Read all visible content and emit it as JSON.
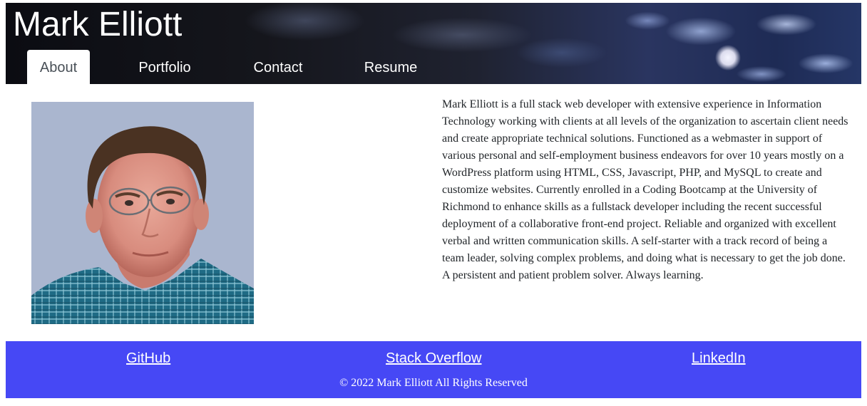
{
  "header": {
    "title": "Mark Elliott",
    "nav": [
      {
        "label": "About",
        "active": true
      },
      {
        "label": "Portfolio",
        "active": false
      },
      {
        "label": "Contact",
        "active": false
      },
      {
        "label": "Resume",
        "active": false
      }
    ]
  },
  "main": {
    "bio": "Mark Elliott is a full stack web developer with extensive experience in Information Technology working with clients at all levels of the organization to ascertain client needs and create appropriate technical solutions. Functioned as a webmaster in support of various personal and self-employment business endeavors for over 10 years mostly on a WordPress platform using HTML, CSS, Javascript, PHP, and MySQL to create and customize websites. Currently enrolled in a Coding Bootcamp at the University of Richmond to enhance skills as a fullstack developer including the recent successful deployment of a collaborative front-end project. Reliable and organized with excellent verbal and written communication skills. A self-starter with a track record of being a team leader, solving complex problems, and doing what is necessary to get the job done. A persistent and patient problem solver. Always learning."
  },
  "footer": {
    "links": [
      {
        "label": "GitHub"
      },
      {
        "label": "Stack Overflow"
      },
      {
        "label": "LinkedIn"
      }
    ],
    "copyright": "© 2022 Mark Elliott All Rights Reserved"
  },
  "colors": {
    "footer_bg": "#4648f5",
    "header_bg": "#15161c",
    "active_tab_text": "#495057",
    "body_text": "#212529"
  }
}
